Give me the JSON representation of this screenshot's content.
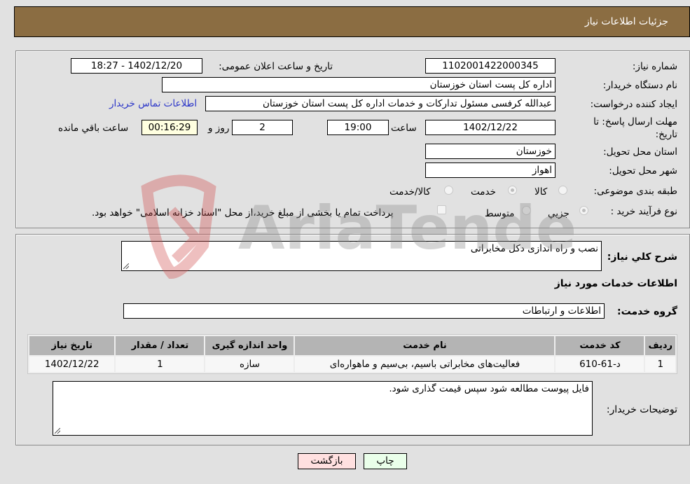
{
  "header": {
    "title": "جزئیات اطلاعات نیاز"
  },
  "form": {
    "need_number_label": "شماره نیاز:",
    "need_number": "1102001422000345",
    "announce_label": "تاریخ و ساعت اعلان عمومی:",
    "announce_value": "1402/12/20 - 18:27",
    "buyer_org_label": "نام دستگاه خریدار:",
    "buyer_org": "اداره کل پست استان خوزستان",
    "creator_label": "ایجاد کننده درخواست:",
    "creator": "عبدالله کرفسی مسئول تدارکات و خدمات اداره کل پست استان خوزستان",
    "contact_link": "اطلاعات تماس خریدار",
    "deadline_label_line1": "مهلت ارسال پاسخ: تا",
    "deadline_label_line2": "تاریخ:",
    "deadline_date": "1402/12/22",
    "time_label": "ساعت",
    "deadline_time": "19:00",
    "days_value": "2",
    "days_label": "روز و",
    "remaining_value": "00:16:29",
    "remaining_label": "ساعت باقي مانده",
    "province_label": "استان محل تحویل:",
    "province": "خوزستان",
    "city_label": "شهر محل تحویل:",
    "city": "اهواز",
    "category_label": "طبقه بندی موضوعی:",
    "category_options": [
      {
        "label": "کالا",
        "checked": false
      },
      {
        "label": "خدمت",
        "checked": true
      },
      {
        "label": "کالا/خدمت",
        "checked": false
      }
    ],
    "process_label": "نوع فرآیند خرید :",
    "process_options": [
      {
        "label": "جزيي",
        "checked": true
      },
      {
        "label": "متوسط",
        "checked": false
      }
    ],
    "payment_note": "پرداخت تمام یا بخشی از مبلغ خرید،از محل \"اسناد خزانه اسلامی\" خواهد بود."
  },
  "details": {
    "description_label": "شرح کلي نیاز:",
    "description": "نصب و راه اندازی دکل مخابراتی",
    "services_heading": "اطلاعات خدمات مورد نیاز",
    "service_group_label": "گروه خدمت:",
    "service_group": "اطلاعات و ارتباطات",
    "table": {
      "headers": [
        "ردیف",
        "کد خدمت",
        "نام خدمت",
        "واحد اندازه گیری",
        "تعداد / مقدار",
        "تاریخ نیاز"
      ],
      "rows": [
        [
          "1",
          "د-61-610",
          "فعالیت‌های مخابراتی باسیم، بی‌سیم و ماهواره‌ای",
          "سازه",
          "1",
          "1402/12/22"
        ]
      ]
    },
    "buyer_notes_label": "توضیحات خریدار:",
    "buyer_notes": "فایل پیوست مطالعه شود سپس قیمت گذاری شود."
  },
  "buttons": {
    "print": "چاپ",
    "back": "بازگشت"
  },
  "watermark": {
    "text": "AriaTender.neT"
  },
  "colors": {
    "header_bg": "#8b6d42",
    "link": "#2b35c8",
    "print_bg": "#eaffea",
    "back_bg": "#ffe0e0",
    "remaining_bg": "#ffffe0"
  }
}
